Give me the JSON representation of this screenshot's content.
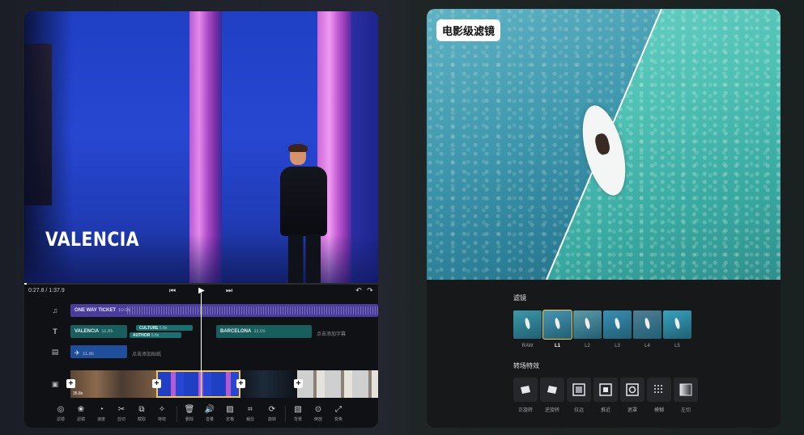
{
  "editor": {
    "title_overlay": "VALENCIA",
    "time": "0:27.8 / 1:37.9",
    "transport": {
      "prev_icon": "skip-back-icon",
      "play_icon": "play-icon",
      "next_icon": "skip-forward-icon",
      "undo_icon": "undo-icon",
      "redo_icon": "redo-icon"
    },
    "tracks": {
      "audio": {
        "label": "ONE WAY TICKET",
        "duration": "10.0s"
      },
      "text": [
        {
          "label": "VALENCIA",
          "duration": "11.8s"
        },
        {
          "label": "CULTURE",
          "duration": "5.8s"
        },
        {
          "label": "AUTHOR",
          "duration": "5.8s"
        },
        {
          "label": "BARCELONA",
          "duration": "11.0s"
        }
      ],
      "text_hint": "点击添加字幕",
      "sticker": {
        "duration": "11.8s"
      },
      "sticker_hint": "点击添加贴纸",
      "video_first_duration": "35.8s"
    },
    "toolbar": [
      {
        "label": "滤镜",
        "icon": "filter-icon"
      },
      {
        "label": "滤镜",
        "icon": "color-icon"
      },
      {
        "label": "速度",
        "icon": "speed-icon"
      },
      {
        "label": "剪切",
        "icon": "scissors-icon"
      },
      {
        "label": "截取",
        "icon": "trim-icon"
      },
      {
        "label": "特效",
        "icon": "effects-icon"
      },
      {
        "label": "删除",
        "icon": "trash-icon"
      },
      {
        "label": "音量",
        "icon": "volume-icon"
      },
      {
        "label": "定格",
        "icon": "freeze-icon"
      },
      {
        "label": "裁剪",
        "icon": "crop-icon"
      },
      {
        "label": "旋转",
        "icon": "rotate-icon"
      },
      {
        "label": "背景",
        "icon": "background-icon"
      },
      {
        "label": "倒放",
        "icon": "reverse-icon"
      },
      {
        "label": "变焦",
        "icon": "zoom-icon"
      }
    ]
  },
  "filter_panel": {
    "badge": "电影级滤镜",
    "filters_title": "滤镜",
    "filters": [
      {
        "label": "RAW",
        "color": "#3c9aa8",
        "selected": false
      },
      {
        "label": "L1",
        "color": "#4a96b3",
        "selected": true
      },
      {
        "label": "L2",
        "color": "#5f9aa9",
        "selected": false
      },
      {
        "label": "L3",
        "color": "#3a8fb6",
        "selected": false
      },
      {
        "label": "L4",
        "color": "#4f7f95",
        "selected": false
      },
      {
        "label": "L5",
        "color": "#37a3bf",
        "selected": false
      }
    ],
    "transitions_title": "转场特效",
    "transitions": [
      {
        "label": "正旋转",
        "icon": "rotate-forward-icon"
      },
      {
        "label": "逆旋转",
        "icon": "rotate-backward-icon"
      },
      {
        "label": "拉远",
        "icon": "zoom-out-icon"
      },
      {
        "label": "推近",
        "icon": "zoom-in-icon"
      },
      {
        "label": "遮罩",
        "icon": "mask-icon"
      },
      {
        "label": "模糊",
        "icon": "blur-icon"
      },
      {
        "label": "左切",
        "icon": "wipe-left-icon"
      }
    ],
    "accent": "#f2c94c"
  }
}
